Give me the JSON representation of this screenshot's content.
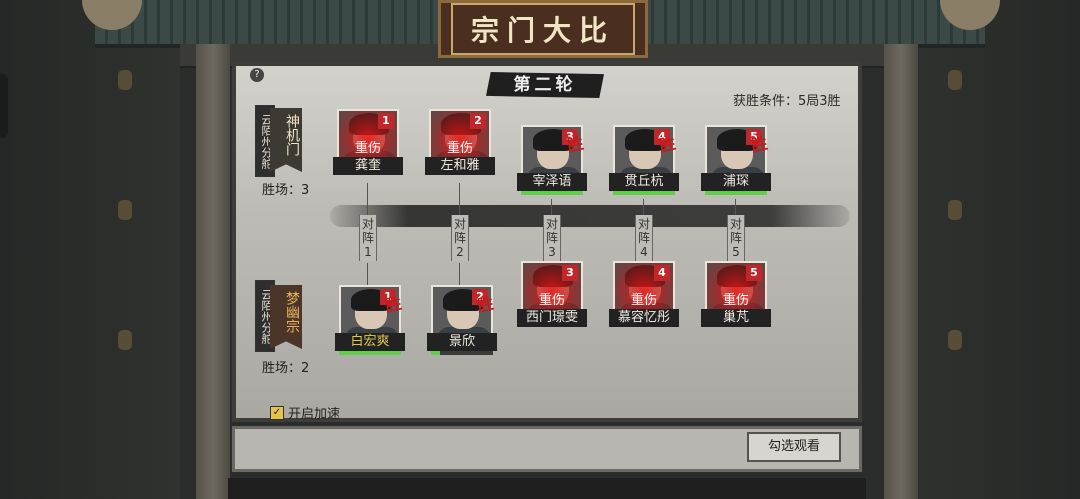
{
  "title": "宗门大比",
  "round": "第二轮",
  "help_icon": "?",
  "win_condition": "获胜条件：5局3胜",
  "top_team": {
    "branch": "云陌州分舵",
    "sect": "神机门",
    "wins": "胜场：3",
    "members": [
      {
        "name": "龚奎",
        "num": "1",
        "status": "重伤",
        "win": ""
      },
      {
        "name": "左和雅",
        "num": "2",
        "status": "重伤",
        "win": ""
      },
      {
        "name": "宰泽语",
        "num": "3",
        "status": "",
        "win": "胜"
      },
      {
        "name": "贯丘杭",
        "num": "4",
        "status": "",
        "win": "胜"
      },
      {
        "name": "浦琛",
        "num": "5",
        "status": "",
        "win": "胜"
      }
    ]
  },
  "bottom_team": {
    "branch": "云陌州分舵",
    "sect": "梦幽宗",
    "wins": "胜场：2",
    "members": [
      {
        "name": "白宏爽",
        "num": "1",
        "status": "",
        "win": "胜"
      },
      {
        "name": "景欣",
        "num": "2",
        "status": "",
        "win": "胜"
      },
      {
        "name": "西门璟雯",
        "num": "3",
        "status": "重伤",
        "win": ""
      },
      {
        "name": "慕容忆彤",
        "num": "4",
        "status": "重伤",
        "win": ""
      },
      {
        "name": "巢芃",
        "num": "5",
        "status": "重伤",
        "win": ""
      }
    ]
  },
  "matchups": [
    "对阵1",
    "对阵2",
    "对阵3",
    "对阵4",
    "对阵5"
  ],
  "speed_toggle": {
    "label": "开启加速",
    "checked": true,
    "check_mark": "✓"
  },
  "watch_button": "勾选观看",
  "colors": {
    "injury_red": "#c0262a",
    "win_red": "#c41c1c",
    "hp_green": "#5fcf47",
    "sect_gold": "#e6b35a"
  }
}
